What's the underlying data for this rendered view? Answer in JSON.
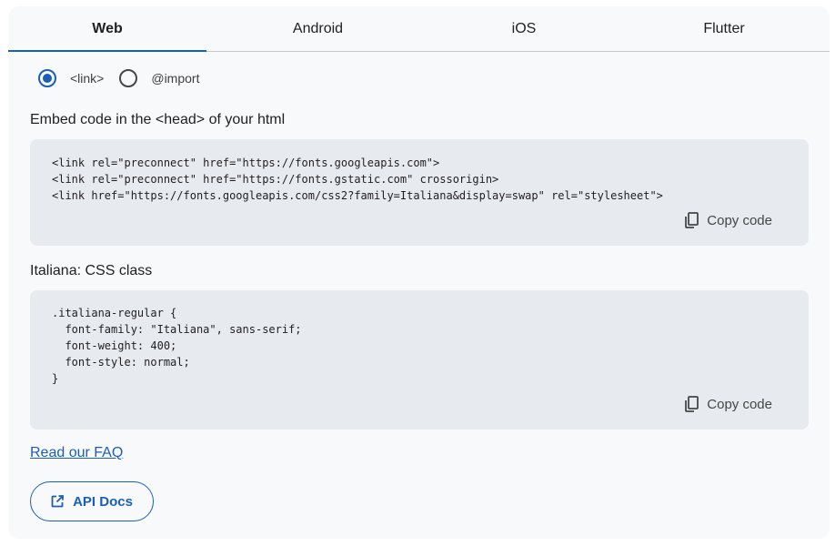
{
  "tabs": [
    {
      "label": "Web",
      "active": true
    },
    {
      "label": "Android",
      "active": false
    },
    {
      "label": "iOS",
      "active": false
    },
    {
      "label": "Flutter",
      "active": false
    }
  ],
  "embed_type": {
    "options": [
      {
        "label": "<link>",
        "checked": true
      },
      {
        "label": "@import",
        "checked": false
      }
    ]
  },
  "embed_section": {
    "heading": "Embed code in the <head> of your html",
    "code": "<link rel=\"preconnect\" href=\"https://fonts.googleapis.com\">\n<link rel=\"preconnect\" href=\"https://fonts.gstatic.com\" crossorigin>\n<link href=\"https://fonts.googleapis.com/css2?family=Italiana&display=swap\" rel=\"stylesheet\">",
    "copy_label": "Copy code"
  },
  "css_section": {
    "heading": "Italiana: CSS class",
    "code": ".italiana-regular {\n  font-family: \"Italiana\", sans-serif;\n  font-weight: 400;\n  font-style: normal;\n}",
    "copy_label": "Copy code"
  },
  "faq_link": "Read our FAQ",
  "api_docs_label": "API Docs",
  "colors": {
    "accent": "#1a5fb4",
    "panel_bg": "#f8f9fb",
    "code_bg": "#e7eaee"
  }
}
